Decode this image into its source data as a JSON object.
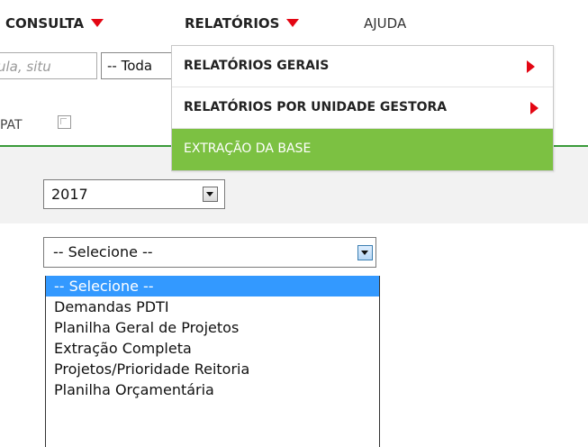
{
  "menu": {
    "items": [
      {
        "label": "CONSULTA",
        "has_arrow": true
      },
      {
        "label": "RELATÓRIOS",
        "has_arrow": true
      },
      {
        "label": "AJUDA",
        "has_arrow": false
      }
    ],
    "arrow_color": "#e30613"
  },
  "background_form": {
    "search_placeholder": "ula, situ",
    "filter_select_value": "-- Toda",
    "pat_label": "PAT"
  },
  "dropdown": {
    "items": [
      {
        "label": "RELATÓRIOS GERAIS",
        "has_submenu": true
      },
      {
        "label": "RELATÓRIOS POR UNIDADE GESTORA",
        "has_submenu": true
      },
      {
        "label": "EXTRAÇÃO DA BASE",
        "has_submenu": false,
        "active": true
      }
    ],
    "active_color": "#7cc142"
  },
  "year_select": {
    "value": "2017"
  },
  "report_select": {
    "value": "-- Selecione --",
    "options": [
      "-- Selecione --",
      "Demandas PDTI",
      "Planilha Geral de Projetos",
      "Extração Completa",
      "Projetos/Prioridade Reitoria",
      "Planilha Orçamentária"
    ],
    "selected_index": 0,
    "highlight_color": "#3399ff"
  }
}
